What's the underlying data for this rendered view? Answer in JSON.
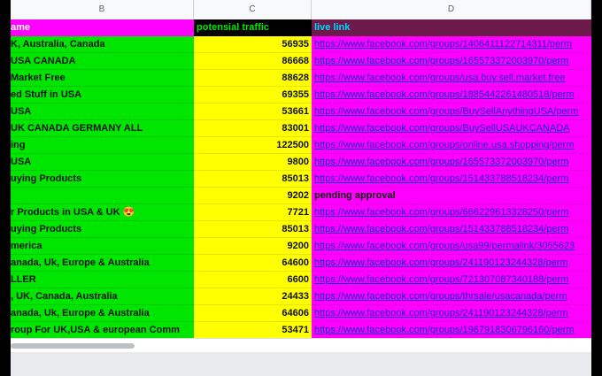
{
  "columns": [
    "B",
    "C",
    "D"
  ],
  "header": {
    "name": "ame",
    "traffic": "potensial traffic",
    "link": "live link"
  },
  "rows": [
    {
      "name": "K, Australia, Canada",
      "traffic": "56935",
      "link": "https://www.facebook.com/groups/1406411122714311/perm"
    },
    {
      "name": "USA CANADA",
      "traffic": "86668",
      "link": "https://www.facebook.com/groups/165573372003970/perm"
    },
    {
      "name": "Market Free",
      "traffic": "88628",
      "link": "https://www.facebook.com/groups/usa.buy.sell.market.free"
    },
    {
      "name": "ed Stuff in USA",
      "traffic": "69355",
      "link": "https://www.facebook.com/groups/1885442261480518/perm"
    },
    {
      "name": "USA",
      "traffic": "53661",
      "link": "https://www.facebook.com/groups/BuySellAnythingUSA/perm"
    },
    {
      "name": "UK CANADA GERMANY ALL",
      "traffic": "83001",
      "link": "https://www.facebook.com/groups/BuySellUSAUKCANADA"
    },
    {
      "name": "ing",
      "traffic": "122500",
      "link": "https://www.facebook.com/groups/online.usa.shopping/perm"
    },
    {
      "name": "USA",
      "traffic": "9800",
      "link": "https://www.facebook.com/groups/165573372003970/perm"
    },
    {
      "name": "uying Products",
      "traffic": "85013",
      "link": "https://www.facebook.com/groups/151433788518234/perm"
    },
    {
      "name": "",
      "traffic": "9202",
      "link": "pending approval",
      "plain": true
    },
    {
      "name": "r Products in USA & UK 😍",
      "traffic": "7721",
      "link": "https://www.facebook.com/groups/666229613328250/perm"
    },
    {
      "name": "uying Products",
      "traffic": "85013",
      "link": "https://www.facebook.com/groups/151433788518234/perm"
    },
    {
      "name": "merica",
      "traffic": "9200",
      "link": "https://www.facebook.com/groups/usa99/permalink/3055623"
    },
    {
      "name": "anada, Uk, Europe & Australia",
      "traffic": "64600",
      "link": "https://www.facebook.com/groups/241190123244328/perm"
    },
    {
      "name": "LLER",
      "traffic": "6600",
      "link": "https://www.facebook.com/groups/721307087340188/perm"
    },
    {
      "name": ", UK, Canada, Australia",
      "traffic": "24433",
      "link": "https://www.facebook.com/groups/thrsale/usacanada/perm"
    },
    {
      "name": "anada, Uk, Europe & Australia",
      "traffic": "64606",
      "link": "https://www.facebook.com/groups/241190123244328/perm"
    },
    {
      "name": "roup For UK,USA & european Comm",
      "traffic": "53471",
      "link": "https://www.facebook.com/groups/1967918306796160/perm"
    }
  ],
  "colors": {
    "name_bg": "#00e600",
    "traffic_bg": "#ffff00",
    "link_bg": "#ff00ff",
    "header_name_bg": "#ff00ff",
    "header_traffic_bg": "#000000",
    "header_link_bg": "#6b1a4a",
    "link_text": "#1a20c8"
  }
}
